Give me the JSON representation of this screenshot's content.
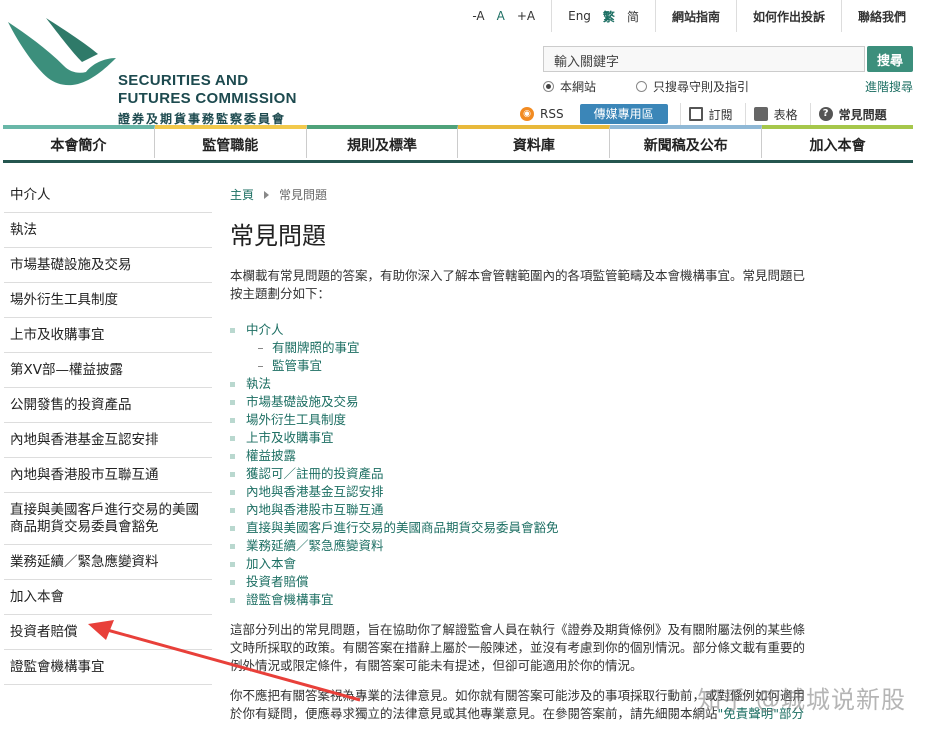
{
  "logo": {
    "en_line1": "SECURITIES AND",
    "en_line2": "FUTURES COMMISSION",
    "zh": "證券及期貨事務監察委員會",
    "brand_color": "#3c8f7c"
  },
  "top_links": {
    "font_size": [
      "-A",
      "A",
      "+A"
    ],
    "lang": [
      "Eng",
      "繁",
      "简"
    ],
    "links": [
      "網站指南",
      "如何作出投訴",
      "聯絡我們"
    ]
  },
  "search": {
    "value": "輸入關鍵字",
    "button": "搜尋",
    "scope_site": "本網站",
    "scope_guides": "只搜尋守則及指引",
    "advanced": "進階搜尋"
  },
  "tools": {
    "rss": "RSS",
    "media": "傳媒專用區",
    "subscribe": "訂閱",
    "forms": "表格",
    "faq": "常見問題"
  },
  "nav": [
    "本會簡介",
    "監管職能",
    "規則及標準",
    "資料庫",
    "新聞稿及公布",
    "加入本會"
  ],
  "sidebar": [
    "中介人",
    "執法",
    "市場基礎設施及交易",
    "場外衍生工具制度",
    "上市及收購事宜",
    "第XV部—權益披露",
    "公開發售的投資產品",
    "內地與香港基金互認安排",
    "內地與香港股市互聯互通",
    "直接與美國客戶進行交易的美國商品期貨交易委員會豁免",
    "業務延續／緊急應變資料",
    "加入本會",
    "投資者賠償",
    "證監會機構事宜"
  ],
  "breadcrumb": {
    "home": "主頁",
    "current": "常見問題"
  },
  "title": "常見問題",
  "intro": "本欄載有常見問題的答案，有助你深入了解本會管轄範圍內的各項監管範疇及本會機構事宜。常見問題已按主題劃分如下：",
  "toc": [
    {
      "label": "中介人",
      "sub": false
    },
    {
      "label": "有關牌照的事宜",
      "sub": true
    },
    {
      "label": "監管事宜",
      "sub": true
    },
    {
      "label": "執法",
      "sub": false
    },
    {
      "label": "市場基礎設施及交易",
      "sub": false
    },
    {
      "label": "場外衍生工具制度",
      "sub": false
    },
    {
      "label": "上市及收購事宜",
      "sub": false
    },
    {
      "label": "權益披露",
      "sub": false
    },
    {
      "label": "獲認可／註冊的投資產品",
      "sub": false
    },
    {
      "label": "內地與香港基金互認安排",
      "sub": false
    },
    {
      "label": "內地與香港股市互聯互通",
      "sub": false
    },
    {
      "label": "直接與美國客戶進行交易的美國商品期貨交易委員會豁免",
      "sub": false
    },
    {
      "label": "業務延續／緊急應變資料",
      "sub": false
    },
    {
      "label": "加入本會",
      "sub": false
    },
    {
      "label": "投資者賠償",
      "sub": false
    },
    {
      "label": "證監會機構事宜",
      "sub": false
    }
  ],
  "para1": "這部分列出的常見問題，旨在協助你了解證監會人員在執行《證券及期貨條例》及有關附屬法例的某些條文時所採取的政策。有關答案在措辭上屬於一般陳述，並沒有考慮到你的個別情況。部分條文載有重要的例外情況或限定條件，有關答案可能未有提述，但卻可能適用於你的情況。",
  "para2": "你不應把有關答案視為專業的法律意見。如你就有關答案可能涉及的事項採取行動前，或對條例如何適用於你有疑問，便應尋求獨立的法律意見或其他專業意見。在參閱答案前，請先細閱本網站",
  "para2_link": "\"免責聲明\"部分",
  "watermark": "知乎 @城城说新股",
  "annotation_color": "#e8403a"
}
